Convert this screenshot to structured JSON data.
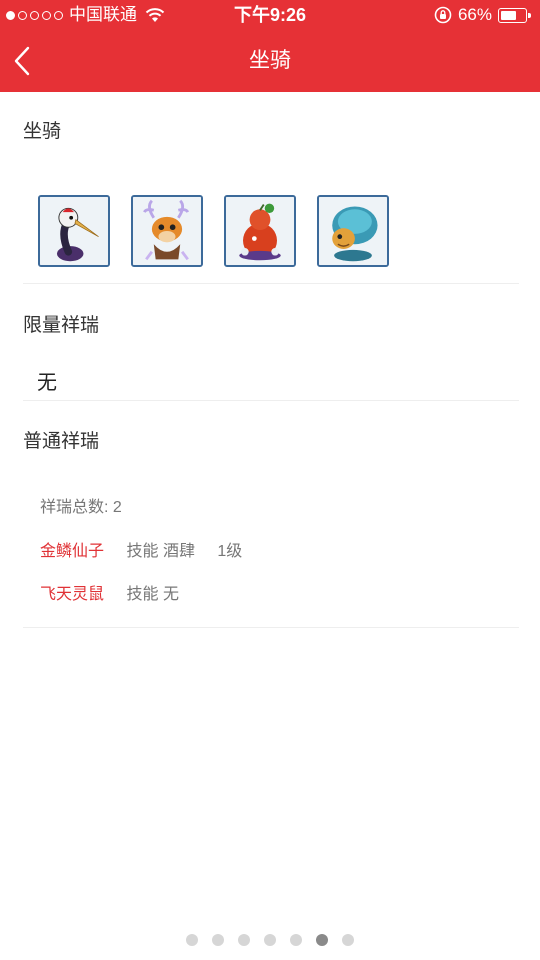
{
  "status_bar": {
    "carrier": "中国联通",
    "time": "下午9:26",
    "battery": "66%",
    "battery_level": 0.66,
    "signal_bars": 1
  },
  "nav": {
    "title": "坐骑",
    "back_icon": "chevron-left-icon"
  },
  "colors": {
    "header_bg": "#e63136",
    "accent_red": "#e03236"
  },
  "sections": {
    "mounts_title": "坐骑",
    "limited_title": "限量祥瑞",
    "limited_value": "无",
    "normal_title": "普通祥瑞"
  },
  "mounts": [
    {
      "icon": "crane-mount-icon"
    },
    {
      "icon": "deer-mount-icon"
    },
    {
      "icon": "gourd-mount-icon"
    },
    {
      "icon": "turtle-mount-icon"
    }
  ],
  "normal": {
    "total_label": "祥瑞总数:",
    "total_value": "2",
    "items": [
      {
        "name": "金鳞仙子",
        "skill_label": "技能",
        "skill": "酒肆",
        "level": "1级"
      },
      {
        "name": "飞天灵鼠",
        "skill_label": "技能",
        "skill": "无",
        "level": ""
      }
    ]
  },
  "pager": {
    "count": 7,
    "active_index": 5
  }
}
